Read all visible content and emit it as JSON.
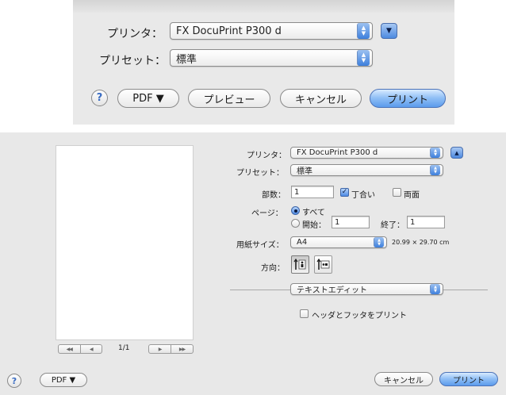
{
  "top_dialog": {
    "printer_label": "プリンタ：",
    "printer_value": "FX DocuPrint P300 d",
    "preset_label": "プリセット：",
    "preset_value": "標準",
    "help_label": "?",
    "pdf_label": "PDF ▼",
    "preview_label": "プレビュー",
    "cancel_label": "キャンセル",
    "print_label": "プリント"
  },
  "bottom_dialog": {
    "printer_label": "プリンタ：",
    "printer_value": "FX DocuPrint P300 d",
    "preset_label": "プリセット：",
    "preset_value": "標準",
    "copies_label": "部数：",
    "copies_value": "1",
    "collate_label": "丁合い",
    "duplex_label": "両面",
    "pages_label": "ページ：",
    "pages_all_label": "すべて",
    "pages_from_label": "開始：",
    "pages_from_value": "1",
    "pages_to_label": "終了：",
    "pages_to_value": "1",
    "paper_size_label": "用紙サイズ：",
    "paper_size_value": "A4",
    "paper_dimensions": "20.99 × 29.70 cm",
    "orientation_label": "方向：",
    "app_section_value": "テキストエディット",
    "header_footer_label": "ヘッダとフッタをプリント",
    "page_counter": "1/1",
    "help_label": "?",
    "pdf_label": "PDF ▼",
    "cancel_label": "キャンセル",
    "print_label": "プリント"
  },
  "state": {
    "collate_checked": true,
    "duplex_checked": false,
    "pages_all_selected": true,
    "header_footer_checked": false
  },
  "icons": [
    "updown-arrows-icon",
    "disclosure-down-icon",
    "disclosure-up-icon",
    "portrait-orientation-icon",
    "landscape-orientation-icon",
    "first-page-icon",
    "previous-page-icon",
    "next-page-icon",
    "last-page-icon",
    "help-icon"
  ],
  "colors": {
    "accent": "#5b9bec",
    "window_bg": "#ececec"
  }
}
